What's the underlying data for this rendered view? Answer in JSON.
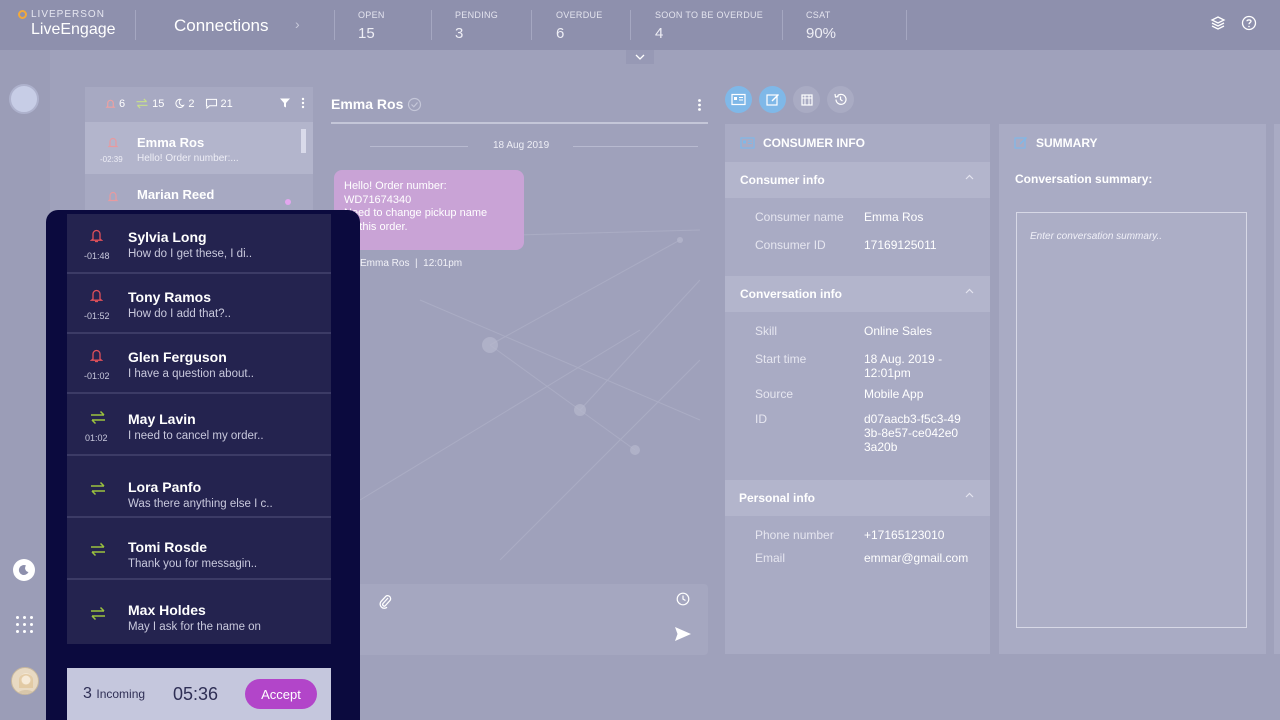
{
  "brand": {
    "company": "LIVEPERSON",
    "product": "LiveEngage"
  },
  "header": {
    "title": "Connections",
    "stats": [
      {
        "label": "OPEN",
        "value": "15"
      },
      {
        "label": "PENDING",
        "value": "3"
      },
      {
        "label": "OVERDUE",
        "value": "6"
      },
      {
        "label": "SOON TO BE OVERDUE",
        "value": "4"
      },
      {
        "label": "CSAT",
        "value": "90%"
      }
    ],
    "icons": [
      "layers-icon",
      "help-icon"
    ]
  },
  "list": {
    "counts": {
      "alerts": "6",
      "transfers": "15",
      "sleeping": "2",
      "messages": "21"
    },
    "rows": [
      {
        "name": "Emma Ros",
        "preview": "Hello! Order number:...",
        "time": "-02:39"
      },
      {
        "name": "Marian Reed",
        "preview": "",
        "time": ""
      }
    ]
  },
  "chat": {
    "title": "Emma Ros",
    "date": "18 Aug 2019",
    "message": "Hello! Order number: WD71674340 Need to change pickup name on this order.",
    "message_lines": [
      "Hello! Order number:",
      "WD71674340",
      "Need to change pickup name",
      "on this order."
    ],
    "meta_name": "Emma Ros",
    "meta_time": "12:01pm"
  },
  "consumer": {
    "header": "CONSUMER INFO",
    "sections": {
      "consumer": {
        "title": "Consumer info",
        "items": [
          {
            "key": "Consumer name",
            "value": "Emma Ros"
          },
          {
            "key": "Consumer ID",
            "value": "17169125011"
          }
        ]
      },
      "conversation": {
        "title": "Conversation info",
        "items": [
          {
            "key": "Skill",
            "value": "Online Sales"
          },
          {
            "key": "Start time",
            "value": "18 Aug. 2019 - 12:01pm"
          },
          {
            "key": "Source",
            "value": "Mobile App"
          },
          {
            "key": "ID",
            "value": "d07aacb3-f5c3-493b-8e57-ce042e03a20b"
          }
        ]
      },
      "personal": {
        "title": "Personal info",
        "items": [
          {
            "key": "Phone number",
            "value": "+17165123010"
          },
          {
            "key": "Email",
            "value": "emmar@gmail.com"
          }
        ]
      }
    }
  },
  "summary": {
    "header": "SUMMARY",
    "label": "Conversation summary:",
    "placeholder": "Enter conversation summary.."
  },
  "incoming": {
    "rows": [
      {
        "name": "Sylvia Long",
        "preview": "How do I get these, I di..",
        "time": "-01:48",
        "icon": "bell-icon"
      },
      {
        "name": "Tony Ramos",
        "preview": "How do I add that?..",
        "time": "-01:52",
        "icon": "bell-icon"
      },
      {
        "name": "Glen Ferguson",
        "preview": "I have a question about..",
        "time": "-01:02",
        "icon": "bell-icon"
      },
      {
        "name": "May Lavin",
        "preview": "I need to cancel my order..",
        "time": "01:02",
        "icon": "transfer-icon"
      },
      {
        "name": "Lora Panfo",
        "preview": "Was there anything else I c..",
        "time": "",
        "icon": "transfer-icon"
      },
      {
        "name": "Tomi Rosde",
        "preview": "Thank you for messagin..",
        "time": "",
        "icon": "transfer-icon"
      },
      {
        "name": "Max Holdes",
        "preview": "May I ask for the name on",
        "time": "",
        "icon": "transfer-icon"
      }
    ],
    "count": "3",
    "count_label": "Incoming",
    "timer": "05:36",
    "accept_label": "Accept"
  },
  "colors": {
    "accent_purple": "#b245c9",
    "bubble": "#c9a3d6",
    "alert_red": "#e0505a",
    "transfer_green": "#9bc33e",
    "tool_blue": "#7fb8e8"
  }
}
